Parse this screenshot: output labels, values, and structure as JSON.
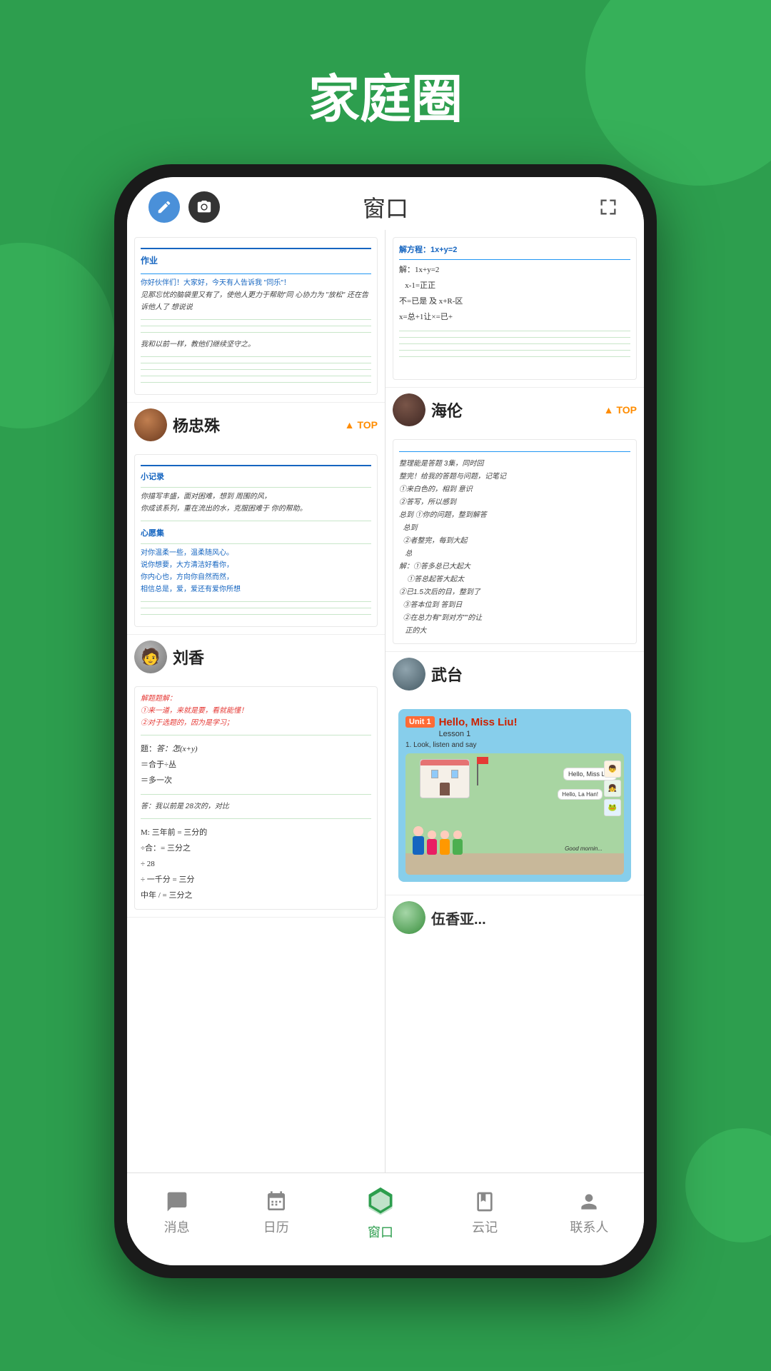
{
  "page": {
    "title": "家庭圈",
    "background_color": "#2d9e4e"
  },
  "phone": {
    "header": {
      "title": "窗口"
    }
  },
  "users": [
    {
      "name": "杨忠殊",
      "badge": "TOP",
      "avatar_color": "#8B4513",
      "column": "left"
    },
    {
      "name": "海伦",
      "badge": "TOP",
      "avatar_color": "#5D4037",
      "column": "right"
    },
    {
      "name": "刘香",
      "avatar_color": "#9E9E9E",
      "column": "left"
    },
    {
      "name": "武台",
      "avatar_color": "#607D8B",
      "column": "right"
    }
  ],
  "nav": {
    "items": [
      {
        "label": "消息",
        "icon": "💬",
        "active": false
      },
      {
        "label": "日历",
        "icon": "📋",
        "active": false
      },
      {
        "label": "窗口",
        "icon": "📦",
        "active": true
      },
      {
        "label": "云记",
        "icon": "📓",
        "active": false
      },
      {
        "label": "联系人",
        "icon": "👤",
        "active": false
      }
    ]
  },
  "textbook": {
    "unit": "Unit 1",
    "title": "Hello, Miss Liu!",
    "lesson": "Lesson 1",
    "instruction": "1. Look, listen and say"
  }
}
